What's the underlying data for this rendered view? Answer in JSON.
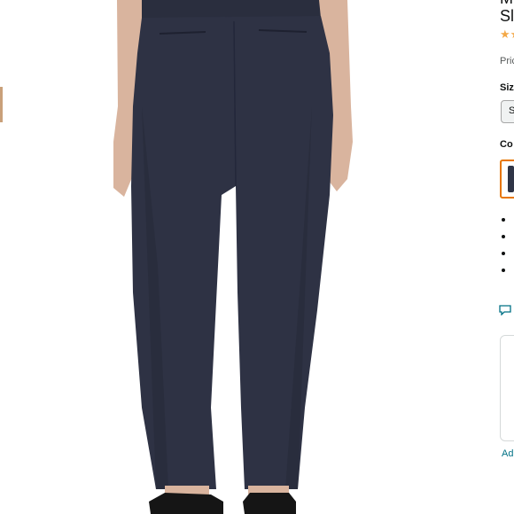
{
  "product": {
    "title_line1": "Mi",
    "title_line2": "Sl",
    "rating_stars": "★★",
    "price_label": "Pric",
    "size_label": "Siz",
    "size_selected": "S",
    "color_label": "Co",
    "bullet_count": 4,
    "add_link": "Ad",
    "image_alt": "Women's navy slim-fit pull-on pants, back view"
  },
  "colors": {
    "pants": "#2e3244",
    "shoes": "#151515",
    "skin": "#d9b49e",
    "star": "#f3a847",
    "swatch_border": "#e77600",
    "link": "#007185"
  },
  "icons": {
    "feedback": "speech-bubble-icon",
    "stars": "star-icon"
  }
}
